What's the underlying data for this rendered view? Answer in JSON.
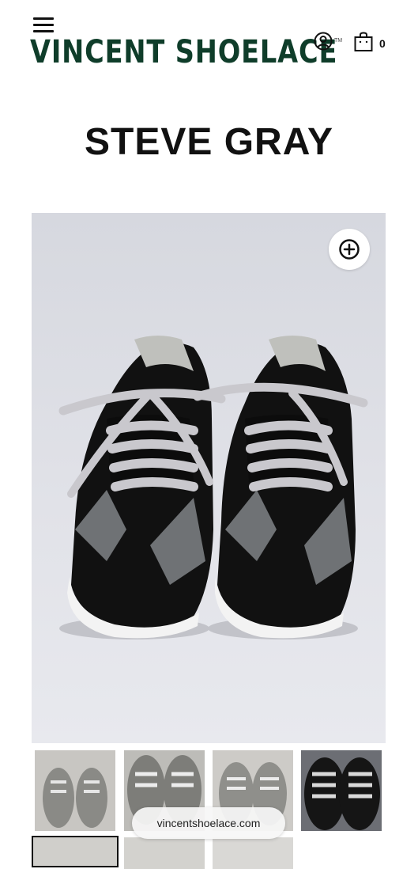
{
  "header": {
    "brand": "VINCENT SHOELACE",
    "trademark": "TM",
    "cart_count": "0"
  },
  "icons": {
    "menu": "hamburger-menu-icon",
    "account": "user-circle-icon",
    "cart": "shopping-bag-icon",
    "zoom": "plus-circle-icon"
  },
  "product": {
    "title": "STEVE GRAY"
  },
  "gallery": {
    "thumbnail_count_visible": 7,
    "selected_index": 4
  },
  "browser": {
    "url": "vincentshoelace.com"
  },
  "colors": {
    "brand": "#0f3d2a",
    "text": "#111111",
    "background": "#ffffff"
  }
}
